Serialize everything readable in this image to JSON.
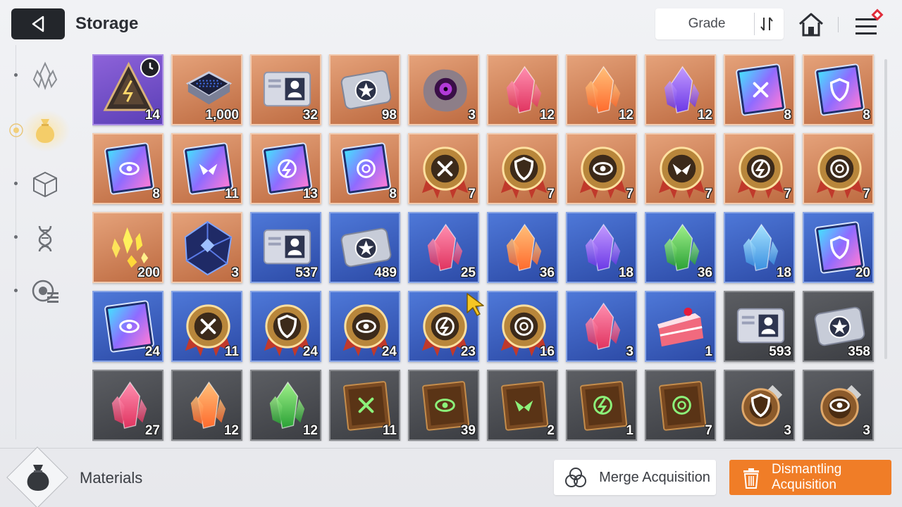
{
  "header": {
    "title": "Storage",
    "grade_label": "Grade"
  },
  "icons": {
    "back": "back-arrow-icon",
    "sort": "sort-icon",
    "home": "home-icon",
    "menu": "menu-icon"
  },
  "sidebar": {
    "items": [
      {
        "name": "crystal-category",
        "icon": "crystal-icon",
        "active": false
      },
      {
        "name": "materials-category",
        "icon": "bag-icon",
        "active": true
      },
      {
        "name": "box-category",
        "icon": "cube-icon",
        "active": false
      },
      {
        "name": "dna-category",
        "icon": "dna-icon",
        "active": false
      },
      {
        "name": "chip-category",
        "icon": "chip-icon",
        "active": false
      }
    ]
  },
  "colors": {
    "accent_orange": "#f07d27",
    "tier_purple": "#6e4ec7",
    "tier_orange": "#d2875c",
    "tier_blue": "#3a5ec0",
    "tier_gray": "#4b4d52"
  },
  "items": [
    {
      "tier": "purple",
      "icon": "pyramid-core",
      "count": "14",
      "timer": true
    },
    {
      "tier": "orange",
      "icon": "chip-board",
      "count": "1,000"
    },
    {
      "tier": "orange",
      "icon": "id-card",
      "count": "32"
    },
    {
      "tier": "orange",
      "icon": "star-ticket",
      "count": "98"
    },
    {
      "tier": "orange",
      "icon": "eye-rock",
      "count": "3"
    },
    {
      "tier": "orange",
      "icon": "pink-crystal",
      "count": "12"
    },
    {
      "tier": "orange",
      "icon": "orange-crystal",
      "count": "12"
    },
    {
      "tier": "orange",
      "icon": "violet-crystal",
      "count": "12"
    },
    {
      "tier": "orange",
      "icon": "sword-manual",
      "count": "8"
    },
    {
      "tier": "orange",
      "icon": "shield-manual",
      "count": "8"
    },
    {
      "tier": "orange",
      "icon": "eye-manual",
      "count": "8"
    },
    {
      "tier": "orange",
      "icon": "wing-manual",
      "count": "11"
    },
    {
      "tier": "orange",
      "icon": "bolt-manual",
      "count": "13"
    },
    {
      "tier": "orange",
      "icon": "orb-manual",
      "count": "8"
    },
    {
      "tier": "orange",
      "icon": "sword-medal",
      "count": "7"
    },
    {
      "tier": "orange",
      "icon": "shield-medal",
      "count": "7"
    },
    {
      "tier": "orange",
      "icon": "eye-medal",
      "count": "7"
    },
    {
      "tier": "orange",
      "icon": "wing-medal",
      "count": "7"
    },
    {
      "tier": "orange",
      "icon": "bolt-medal",
      "count": "7"
    },
    {
      "tier": "orange",
      "icon": "orb-medal",
      "count": "7"
    },
    {
      "tier": "orange",
      "icon": "gold-shards",
      "count": "200"
    },
    {
      "tier": "orange",
      "icon": "dark-cube",
      "count": "3"
    },
    {
      "tier": "blue",
      "icon": "id-card",
      "count": "537"
    },
    {
      "tier": "blue",
      "icon": "star-ticket",
      "count": "489"
    },
    {
      "tier": "blue",
      "icon": "pink-crystal",
      "count": "25"
    },
    {
      "tier": "blue",
      "icon": "orange-crystal",
      "count": "36"
    },
    {
      "tier": "blue",
      "icon": "violet-crystal",
      "count": "18"
    },
    {
      "tier": "blue",
      "icon": "green-crystal",
      "count": "36"
    },
    {
      "tier": "blue",
      "icon": "cyan-crystal",
      "count": "18"
    },
    {
      "tier": "blue",
      "icon": "shield-manual",
      "count": "20"
    },
    {
      "tier": "blue",
      "icon": "eye-manual",
      "count": "24"
    },
    {
      "tier": "blue",
      "icon": "sword-medal",
      "count": "11"
    },
    {
      "tier": "blue",
      "icon": "shield-medal",
      "count": "24"
    },
    {
      "tier": "blue",
      "icon": "eye-medal",
      "count": "24"
    },
    {
      "tier": "blue",
      "icon": "bolt-medal",
      "count": "23"
    },
    {
      "tier": "blue",
      "icon": "orb-medal",
      "count": "16"
    },
    {
      "tier": "blue",
      "icon": "ice-crystal",
      "count": "3"
    },
    {
      "tier": "blue",
      "icon": "cake-slice",
      "count": "1"
    },
    {
      "tier": "gray",
      "icon": "id-card",
      "count": "593"
    },
    {
      "tier": "gray",
      "icon": "star-ticket",
      "count": "358"
    },
    {
      "tier": "gray",
      "icon": "pink-crystal",
      "count": "27"
    },
    {
      "tier": "gray",
      "icon": "orange-crystal",
      "count": "12"
    },
    {
      "tier": "gray",
      "icon": "green-crystal",
      "count": "12"
    },
    {
      "tier": "gray",
      "icon": "sword-book",
      "count": "11"
    },
    {
      "tier": "gray",
      "icon": "eye-book",
      "count": "39"
    },
    {
      "tier": "gray",
      "icon": "wing-book",
      "count": "2"
    },
    {
      "tier": "gray",
      "icon": "bolt-book",
      "count": "1"
    },
    {
      "tier": "gray",
      "icon": "orb-book",
      "count": "7"
    },
    {
      "tier": "gray",
      "icon": "shield-coin",
      "count": "3"
    },
    {
      "tier": "gray",
      "icon": "eye-coin",
      "count": "3"
    }
  ],
  "footer": {
    "category_label": "Materials",
    "category_icon": "bag-icon",
    "merge_label": "Merge Acquisition",
    "merge_icon": "merge-circles-icon",
    "dismantle_label": "Dismantling Acquisition",
    "dismantle_icon": "trash-icon"
  }
}
